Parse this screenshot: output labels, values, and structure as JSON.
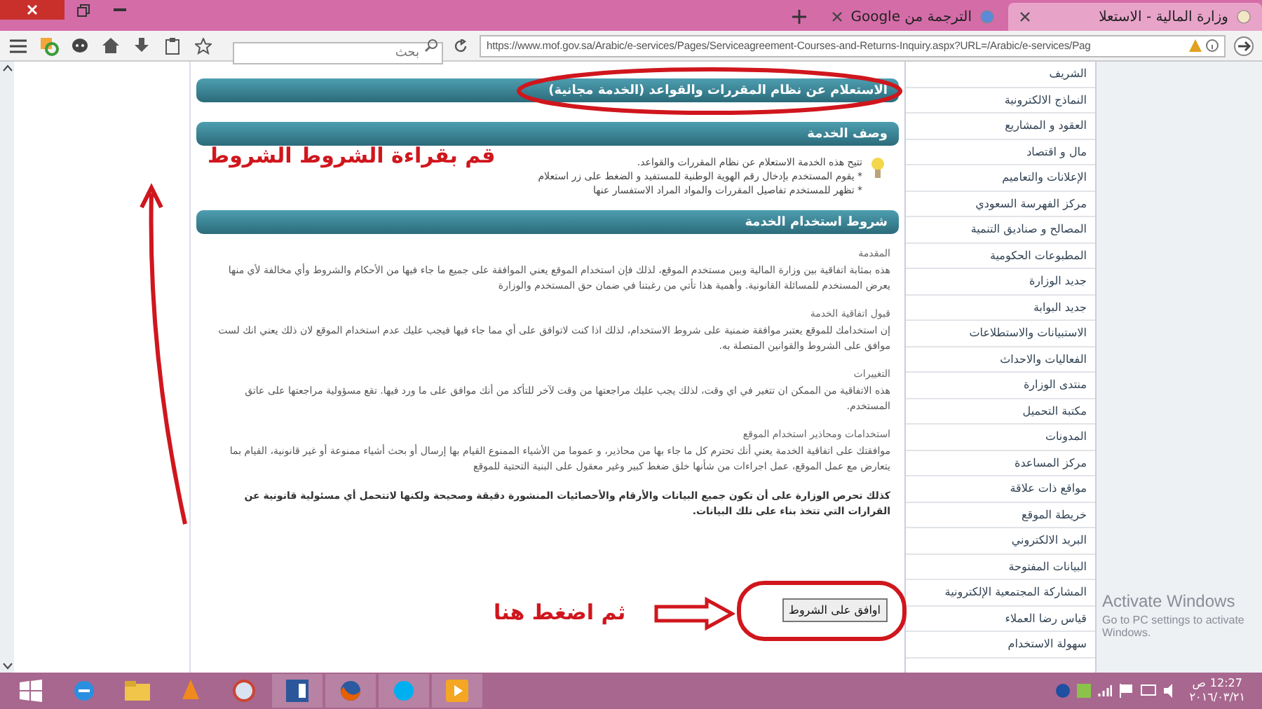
{
  "browser": {
    "tabs": [
      {
        "title": "وزارة المالية - الاستعلا",
        "selected": true
      },
      {
        "title": "الترجمة من Google",
        "selected": false
      }
    ],
    "search": {
      "placeholder": "بحث"
    },
    "url": "https://www.mof.gov.sa/Arabic/e-services/Pages/Serviceagreement-Courses-and-Returns-Inquiry.aspx?URL=/Arabic/e-services/Pag"
  },
  "page": {
    "title": "الاستعلام عن نظام المقررات والقواعد (الخدمة مجانية)",
    "description_heading": "وصف الخدمة",
    "description_intro": "تتيح هذه الخدمة الاستعلام عن نظام المقررات والقواعد.",
    "description_bullets": [
      "* يقوم المستخدم بإدخال رقم الهوية الوطنية للمستفيد و الضغط على زر استعلام",
      "* تظهر للمستخدم تفاصيل المقررات والمواد المراد الاستفسار عنها"
    ],
    "terms_heading": "شروط استخدام الخدمة",
    "sections": [
      {
        "title": "المقدمة",
        "text": "هذه بمثابة اتفاقية بين وزارة المالية وبين مستخدم الموقع، لذلك فإن استخدام الموقع يعني الموافقة على جميع ما جاء فيها من الأحكام والشروط وأي مخالفة لأي منها يعرض المستخدم للمسائلة القانونية. وأهمية هذا تأتي من رغبتنا في ضمان حق المستخدم والوزارة"
      },
      {
        "title": "قبول اتفاقية الخدمة",
        "text": "إن استخدامك للموقع يعتبر موافقة ضمنية على شروط الاستخدام، لذلك اذا كنت لاتوافق على أي مما جاء فيها فيجب عليك عدم استخدام الموقع لان ذلك يعني انك لست موافق على الشروط والقوانين المتصلة به."
      },
      {
        "title": "التغييرات",
        "text": "هذه الاتفاقية من الممكن ان تتغير في اي وقت، لذلك يجب عليك مراجعتها من وقت لآخر للتأكد من أنك موافق على ما ورد فيها. تقع مسؤولية مراجعتها على عاتق المستخدم."
      },
      {
        "title": "استخدامات ومحاذير استخدام الموقع",
        "text": "موافقتك على اتفاقية الخدمة يعني أنك تحترم كل ما جاء بها من محاذير، و عموما من الأشياء الممنوع القيام بها إرسال أو بحث أشياء ممنوعة أو غير قانونية، القيام بما يتعارض مع عمل الموقع، عمل اجراءات من شأنها خلق ضغط كبير وغير معقول على البنية التحتية للموقع"
      }
    ],
    "notice": "كذلك تحرص الوزارة على أن تكون جميع البيانات والأرقام والأحصائيات المنشورة دقيقة وصحيحة ولكنها لاتتحمل أي مسئولية قانونية عن القرارات التي تتخذ بناء على تلك البيانات.",
    "agree_button": "اوافق على الشروط"
  },
  "sidebar": {
    "items": [
      "الشريف",
      "النماذج الالكترونية",
      "العقود و المشاريع",
      "مال و اقتصاد",
      "الإعلانات والتعاميم",
      "مركز الفهرسة السعودي",
      "المصالح و صناديق التنمية",
      "المطبوعات الحكومية",
      "جديد الوزارة",
      "جديد البوابة",
      "الاستبيانات والاستطلاعات",
      "الفعاليات والاحداث",
      "منتدى الوزارة",
      "مكتبة التحميل",
      "المدونات",
      "مركز المساعدة",
      "مواقع ذات علاقة",
      "خريطة الموقع",
      "البريد الالكتروني",
      "البيانات المفتوحة",
      "المشاركة المجتمعية الإلكترونية",
      "قياس رضا العملاء",
      "سهولة الاستخدام"
    ]
  },
  "annotations": {
    "read_hint": "قم بقراءة الشروط الشروط",
    "click_hint": "ثم اضغط هنا"
  },
  "os_overlay": {
    "line_1": "Activate Windows",
    "line_2": "Go to PC settings to activate Windows."
  },
  "taskbar": {
    "time": "12:27",
    "period": "ص",
    "date": "٢٠١٦/٠٣/٢١"
  }
}
